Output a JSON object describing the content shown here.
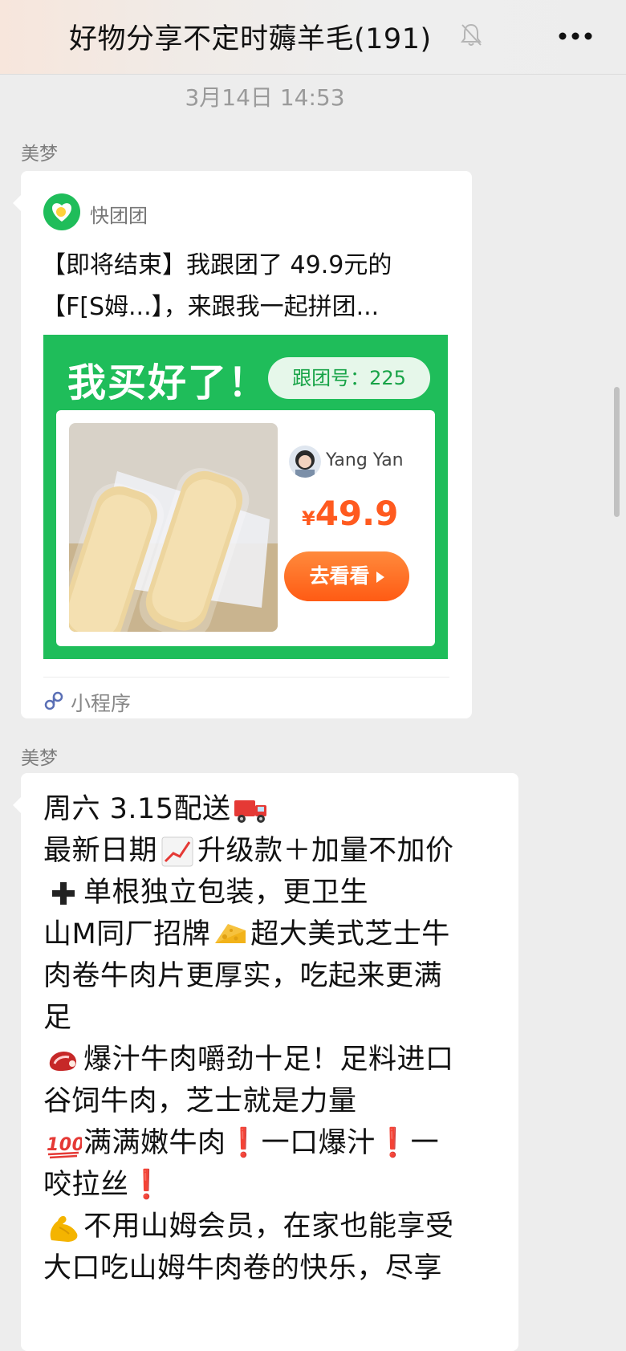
{
  "header": {
    "title": "好物分享不定时薅羊毛(191)",
    "mute_icon": "bell-slash-icon",
    "more_icon": "more-dots-icon"
  },
  "timestamp": "3月14日 14:53",
  "messages": [
    {
      "sender": "美梦",
      "type": "mini-program-card",
      "brand": "快团团",
      "text_lines": [
        "【即将结束】我跟团了 49.9元的",
        "【F[S姆...】，来跟我一起拼团..."
      ],
      "banner": {
        "headline": "我买好了！",
        "group_label": "跟团号：225",
        "user_name": "Yang Yan",
        "price_symbol": "¥",
        "price": "49.9",
        "button_label": "去看看"
      },
      "footer_label": "小程序",
      "footer_icon": "mini-program-link-icon"
    },
    {
      "sender": "美梦",
      "type": "text",
      "lines": [
        {
          "before": "周六 3.15配送",
          "emoji": "delivery-truck",
          "after": ""
        },
        {
          "before": "最新日期",
          "emoji": "chart-increasing",
          "after": "升级款＋加量不加价"
        },
        {
          "before": "",
          "emoji": "heavy-plus",
          "after": "单根独立包装，更卫生"
        },
        {
          "before": "山M同厂招牌",
          "emoji": "cheese-wedge",
          "after": "超大美式芝士牛"
        },
        {
          "before": "肉卷牛肉片更厚实，吃起来更满",
          "emoji": "",
          "after": ""
        },
        {
          "before": "足",
          "emoji": "",
          "after": ""
        },
        {
          "before": "",
          "emoji": "cut-of-meat",
          "after": "爆汁牛肉嚼劲十足！足料进口"
        },
        {
          "before": "谷饲牛肉，芝士就是力量",
          "emoji": "",
          "after": ""
        },
        {
          "before": "",
          "emoji": "hundred-points",
          "after": "满满嫩牛肉❗一口爆汁❗一"
        },
        {
          "before": "咬拉丝❗",
          "emoji": "",
          "after": ""
        },
        {
          "before": "",
          "emoji": "flexed-biceps",
          "after": "不用山姆会员，在家也能享受"
        },
        {
          "before": "大口吃山姆牛肉卷的快乐，尽享",
          "emoji": "",
          "after": ""
        }
      ]
    }
  ],
  "colors": {
    "background": "#ededed",
    "bubble": "#ffffff",
    "banner_green": "#1fbd5a",
    "price_orange": "#ff5a1f",
    "button_orange": "#ff6a22"
  }
}
